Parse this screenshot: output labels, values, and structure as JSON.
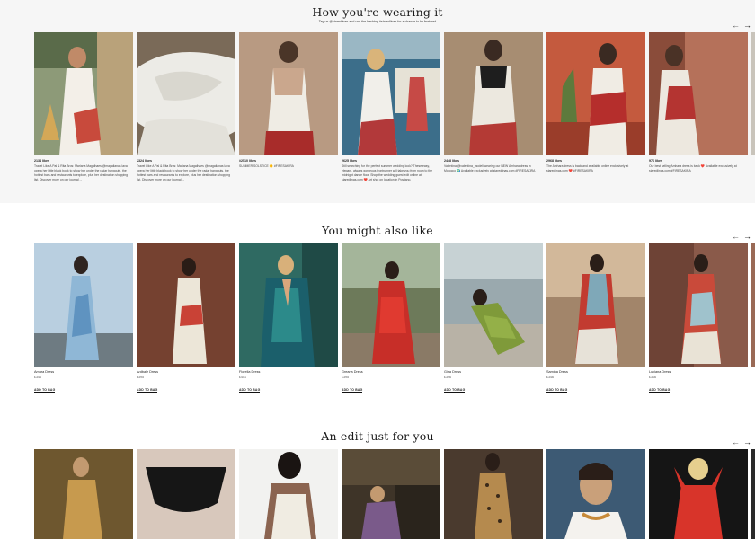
{
  "sections": {
    "wearing": {
      "title": "How you're wearing it",
      "subtitle": "Tag us @staredlinas and use the hashtag #staredlinas for a chance to be featured",
      "posts": [
        {
          "likes": "2134 likes",
          "caption": "Travel Like A Pal & Rita Bros: Mariana Magalhaes @magalianas lava opera her little black book to show her under the radar hangouts, the hottest bars and restaurants to explore, plus her destination shopping list. Discover more on our journal ..."
        },
        {
          "likes": "2324 likes",
          "caption": "Travel Like A Pal & Rita Bros: Mariana Magalhaes @magalianas lava opera her little black book to show her under the radar hangouts, the hottest bars and restaurants to explore, plus her destination shopping list. Discover more on our journal ..."
        },
        {
          "likes": "#2510 likes",
          "caption": "SUMMER SOLSTICE 🌞 #FIRESAKIRA"
        },
        {
          "likes": "2625 likes",
          "caption": "Still searching for the perfect summer wedding look? These easy, elegant, always gorgeous frontrunner will take you from noon to the midnight dance floor. Shop the wedding guest edit online at staredlinas.com ❤️ Art shot on location in Positano."
        },
        {
          "likes": "2448 likes",
          "caption": "Valentina @valentina_modeli wearing our NEW Amhara dress in Morocco 🌍 Available exclusively at staredlinas.com #FIRESAKIRA"
        },
        {
          "likes": "2968 likes",
          "caption": "The Amhara dress is back and available online exclusively at staredlinas.com ❤️ #FIRESAKIRA"
        },
        {
          "likes": "976 likes",
          "caption": "Our best selling Amhara dress is back ❤️ Available exclusively at staredlinas.com #FIRESAKIRA"
        }
      ]
    },
    "also_like": {
      "title": "You might also like",
      "add_label": "ADD TO BAG",
      "products": [
        {
          "name": "Amara Dress",
          "price": "£346"
        },
        {
          "name": "Ardbale Dress",
          "price": "£395"
        },
        {
          "name": "Fiorella Dress",
          "price": "£451"
        },
        {
          "name": "Greana Dress",
          "price": "£395"
        },
        {
          "name": "Gina Dress",
          "price": "£396"
        },
        {
          "name": "Samina Dress",
          "price": "£346"
        },
        {
          "name": "Luciana Dress",
          "price": "£316"
        }
      ]
    },
    "edit": {
      "title": "An edit just for you"
    }
  },
  "icons": {
    "prev": "arrow-left-icon",
    "next": "arrow-right-icon"
  },
  "arrow_glyphs": {
    "prev": "←",
    "next": "→"
  },
  "colors": {
    "band_gray": "#f6f6f6",
    "text_dark": "#1a1a1a"
  }
}
